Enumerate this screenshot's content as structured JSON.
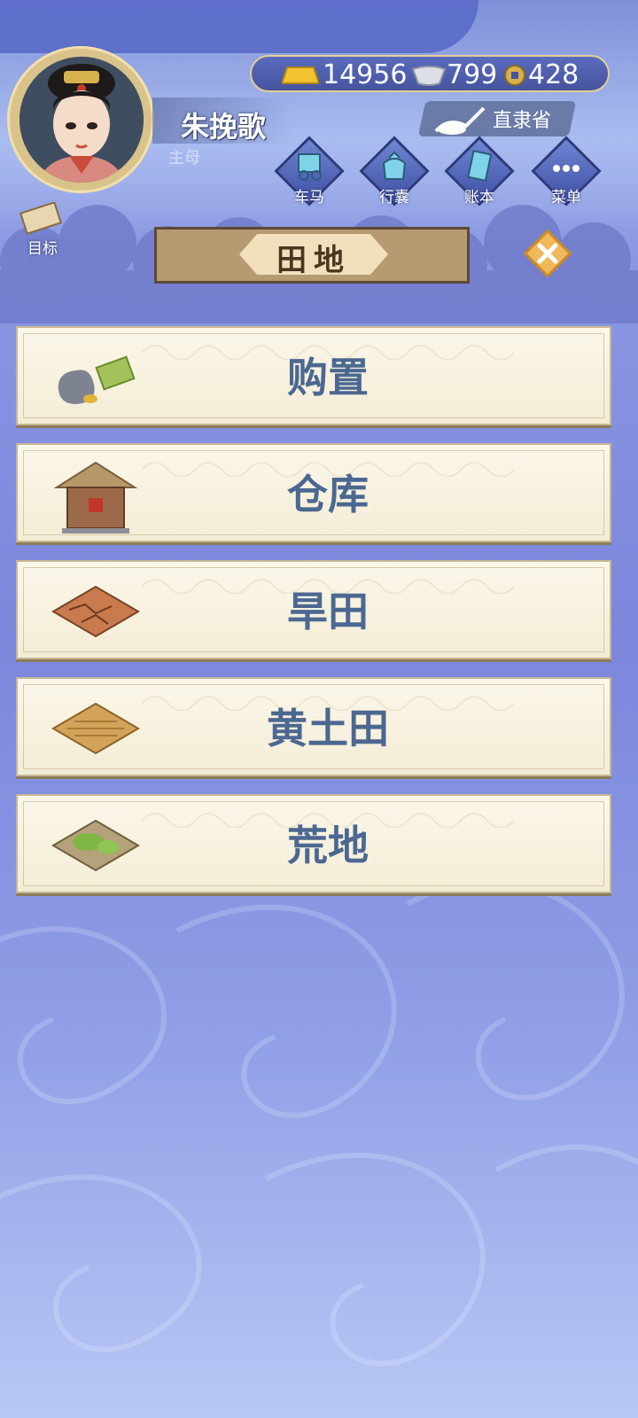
{
  "header": {
    "player_name": "朱挽歌",
    "player_role": "主母"
  },
  "currency": {
    "gold": "14956",
    "silver": "799",
    "coin": "428"
  },
  "location": {
    "label": "直隶省"
  },
  "menu_buttons": [
    {
      "label": "车马",
      "icon": "carriage-icon"
    },
    {
      "label": "行囊",
      "icon": "bag-icon"
    },
    {
      "label": "账本",
      "icon": "ledger-icon"
    },
    {
      "label": "菜单",
      "icon": "more-icon"
    }
  ],
  "goal": {
    "label": "目标",
    "icon": "scroll-icon"
  },
  "panel": {
    "title": "田地"
  },
  "items": [
    {
      "label": "购置",
      "icon": "purchase-icon"
    },
    {
      "label": "仓库",
      "icon": "warehouse-icon"
    },
    {
      "label": "旱田",
      "icon": "dry-field-icon"
    },
    {
      "label": "黄土田",
      "icon": "loess-field-icon"
    },
    {
      "label": "荒地",
      "icon": "wasteland-icon"
    }
  ],
  "colors": {
    "accent_gold": "#e3cf95",
    "label_blue": "#4b6891",
    "panel_cream": "#fbf7e9"
  }
}
